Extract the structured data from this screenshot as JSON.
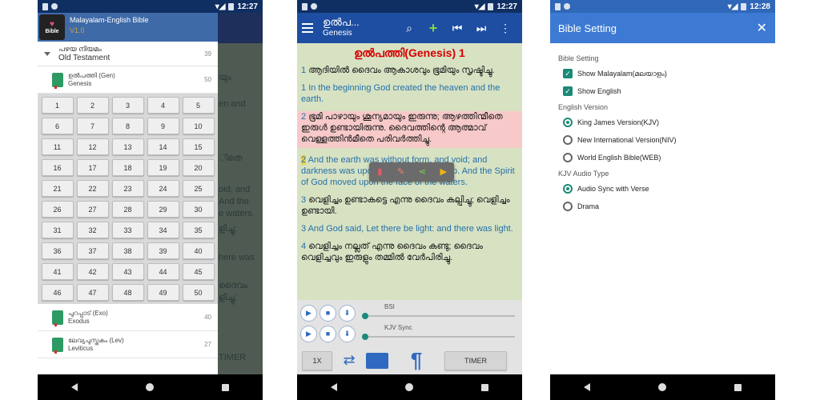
{
  "status": {
    "time1": "12:27",
    "time2": "12:27",
    "time3": "12:28"
  },
  "drawer": {
    "app_title": "Malayalam-English Bible",
    "version": "V1.0",
    "logo_text": "Bible",
    "old_testament": {
      "ml": "പഴയ നിയമം",
      "en": "Old Testament",
      "count": "39"
    },
    "genesis": {
      "ml": "ഉൽപത്തി (Gen)",
      "en": "Genesis",
      "count": "50"
    },
    "exodus": {
      "ml": "പുറപ്പാട് (Exo)",
      "en": "Exodus",
      "count": "40"
    },
    "leviticus": {
      "ml": "ലേവ്യപുസ്തകം (Lev)",
      "en": "Leviticus",
      "count": "27"
    },
    "chapters": [
      "1",
      "2",
      "3",
      "4",
      "5",
      "6",
      "7",
      "8",
      "9",
      "10",
      "11",
      "12",
      "13",
      "14",
      "15",
      "16",
      "17",
      "18",
      "19",
      "20",
      "21",
      "22",
      "23",
      "24",
      "25",
      "26",
      "27",
      "28",
      "29",
      "30",
      "31",
      "32",
      "33",
      "34",
      "35",
      "36",
      "37",
      "38",
      "39",
      "40",
      "41",
      "42",
      "43",
      "44",
      "45",
      "46",
      "47",
      "48",
      "49",
      "50"
    ],
    "bg_texts": [
      "യും",
      "en and",
      "ിതെ",
      "oid; and",
      "And the",
      "e waters.",
      "ളിച്ചു;",
      "here was",
      "ദൈവം",
      "ളിച്ചു;",
      "TIMER"
    ]
  },
  "reader": {
    "title": "ഉൽപ...",
    "subtitle": "Genesis",
    "chapter_heading": "ഉൽപത്തി(Genesis) 1",
    "verses": [
      {
        "n": "1",
        "text": "ആദിയിൽ ദൈവം ആകാശവും ഭൂമിയും സൃഷ്ടിച്ചു.",
        "en": false
      },
      {
        "n": "1",
        "text": "In the beginning God created the heaven and the earth.",
        "en": true
      },
      {
        "n": "2",
        "text": "ഭൂമി പാഴായും ശൂന്യമായും ഇരുന്നു; ആഴത്തിന്മീതെ ഇരുൾ ഉണ്ടായിരുന്നു. ദൈവത്തിന്റെ ആത്മാവ് വെള്ളത്തിൻമീതെ പരിവർത്തിച്ചു.",
        "en": false
      },
      {
        "n": "2",
        "text": "And the earth was without form, and void; and darkness was upon the face of the deep. And the Spirit of God moved upon the face of the waters.",
        "en": true
      },
      {
        "n": "3",
        "text": "വെളിച്ചം ഉണ്ടാകട്ടെ എന്നു ദൈവം കല്പിച്ചു; വെളിച്ചം ഉണ്ടായി.",
        "en": false
      },
      {
        "n": "3",
        "text": "And God said, Let there be light: and there was light.",
        "en": true
      },
      {
        "n": "4",
        "text": "വെളിച്ചം നല്ലത് എന്നു ദൈവം കണ്ടു; ദൈവം വെളിച്ചവും ഇരുളും തമ്മിൽ വേർപിരിച്ചു.",
        "en": false
      }
    ],
    "audio1_label": "BSI",
    "audio2_label": "KJV Sync",
    "speed": "1X",
    "timer": "TIMER",
    "pilcrow": "¶"
  },
  "settings": {
    "title": "Bible Setting",
    "section1": "Bible Setting",
    "show_malayalam": "Show Malayalam(മലയാളം)",
    "show_english": "Show English",
    "section2": "English Version",
    "kjv": "King James Version(KJV)",
    "niv": "New International Version(NIV)",
    "web": "World English Bible(WEB)",
    "section3": "KJV Audio Type",
    "audio_sync": "Audio Sync with Verse",
    "drama": "Drama"
  }
}
